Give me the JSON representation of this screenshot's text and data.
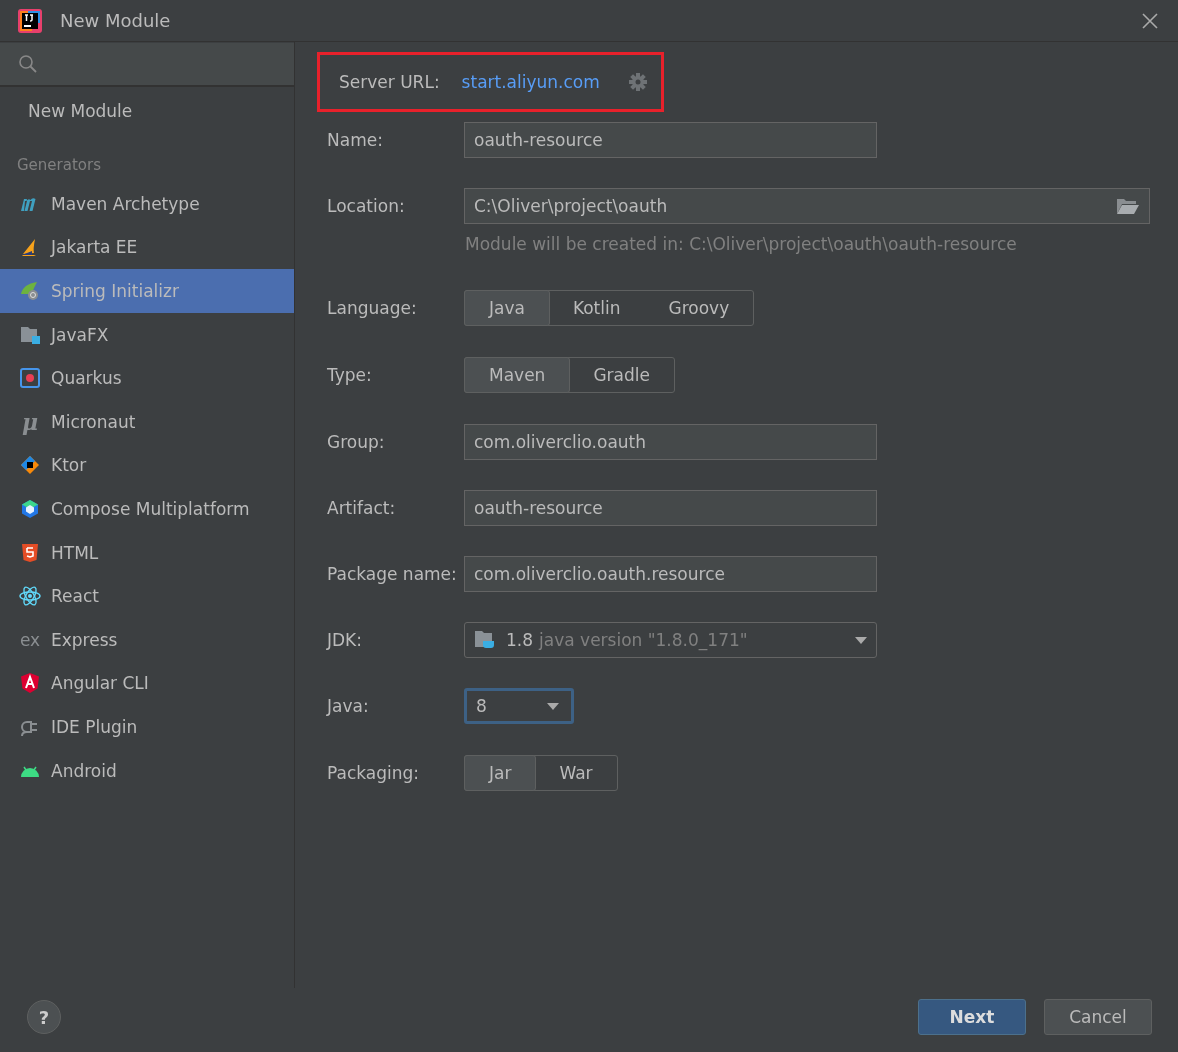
{
  "window": {
    "title": "New Module"
  },
  "sidebar": {
    "top_item": "New Module",
    "section": "Generators",
    "items": [
      {
        "label": "Maven Archetype",
        "selected": false
      },
      {
        "label": "Jakarta EE",
        "selected": false
      },
      {
        "label": "Spring Initializr",
        "selected": true
      },
      {
        "label": "JavaFX",
        "selected": false
      },
      {
        "label": "Quarkus",
        "selected": false
      },
      {
        "label": "Micronaut",
        "selected": false,
        "glyph": "μ"
      },
      {
        "label": "Ktor",
        "selected": false
      },
      {
        "label": "Compose Multiplatform",
        "selected": false
      },
      {
        "label": "HTML",
        "selected": false
      },
      {
        "label": "React",
        "selected": false
      },
      {
        "label": "Express",
        "selected": false,
        "glyph": "ex"
      },
      {
        "label": "Angular CLI",
        "selected": false
      },
      {
        "label": "IDE Plugin",
        "selected": false
      },
      {
        "label": "Android",
        "selected": false
      }
    ]
  },
  "server": {
    "label": "Server URL:",
    "url": "start.aliyun.com",
    "highlighted": true
  },
  "fields": [
    {
      "kind": "text",
      "label": "Name:",
      "value": "oauth-resource"
    },
    {
      "kind": "path",
      "label": "Location:",
      "value": "C:\\Oliver\\project\\oauth",
      "hint": "Module will be created in: C:\\Oliver\\project\\oauth\\oauth-resource"
    },
    {
      "kind": "toggle",
      "label": "Language:",
      "options": [
        {
          "label": "Java",
          "selected": true
        },
        {
          "label": "Kotlin",
          "selected": false
        },
        {
          "label": "Groovy",
          "selected": false
        }
      ]
    },
    {
      "kind": "toggle",
      "label": "Type:",
      "options": [
        {
          "label": "Maven",
          "selected": true
        },
        {
          "label": "Gradle",
          "selected": false
        }
      ]
    },
    {
      "kind": "text",
      "label": "Group:",
      "value": "com.oliverclio.oauth"
    },
    {
      "kind": "text",
      "label": "Artifact:",
      "value": "oauth-resource"
    },
    {
      "kind": "text",
      "label": "Package name:",
      "value": "com.oliverclio.oauth.resource"
    },
    {
      "kind": "jdk",
      "label": "JDK:",
      "value": "1.8",
      "detail": "java version \"1.8.0_171\""
    },
    {
      "kind": "combo",
      "label": "Java:",
      "value": "8",
      "focused": true
    },
    {
      "kind": "toggle",
      "label": "Packaging:",
      "options": [
        {
          "label": "Jar",
          "selected": true
        },
        {
          "label": "War",
          "selected": false
        }
      ]
    }
  ],
  "help": "?",
  "buttons": [
    {
      "label": "Next",
      "primary": true
    },
    {
      "label": "Cancel",
      "primary": false
    }
  ]
}
